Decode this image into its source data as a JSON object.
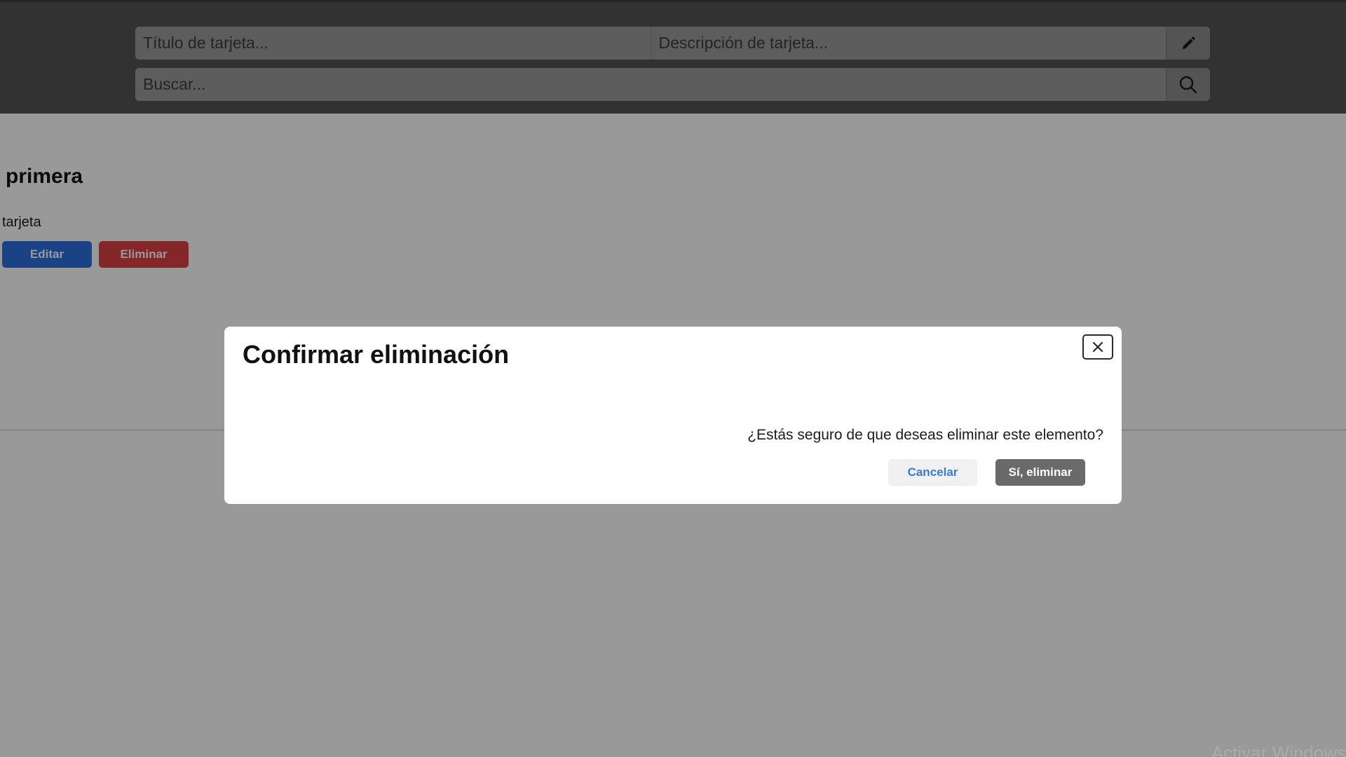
{
  "header": {
    "title_input": {
      "placeholder": "Título de tarjeta..."
    },
    "description_input": {
      "placeholder": "Descripción de tarjeta..."
    },
    "edit_icon": "pencil-icon",
    "search_input": {
      "placeholder": "Buscar..."
    },
    "search_icon": "search-icon"
  },
  "card": {
    "title": "primera",
    "description": "tarjeta",
    "edit_label": "Editar",
    "delete_label": "Eliminar"
  },
  "modal": {
    "title": "Confirmar eliminación",
    "message": "¿Estás seguro de que deseas eliminar este elemento?",
    "cancel_label": "Cancelar",
    "confirm_label": "Sí, eliminar",
    "close_icon": "close-icon"
  },
  "watermark": "Activar Windows",
  "colors": {
    "header_bg": "#545454",
    "edit_button": "#2f6fe0",
    "delete_button": "#dc4144",
    "cancel_text": "#3a7ad8",
    "confirm_button": "#6a6a6a"
  }
}
